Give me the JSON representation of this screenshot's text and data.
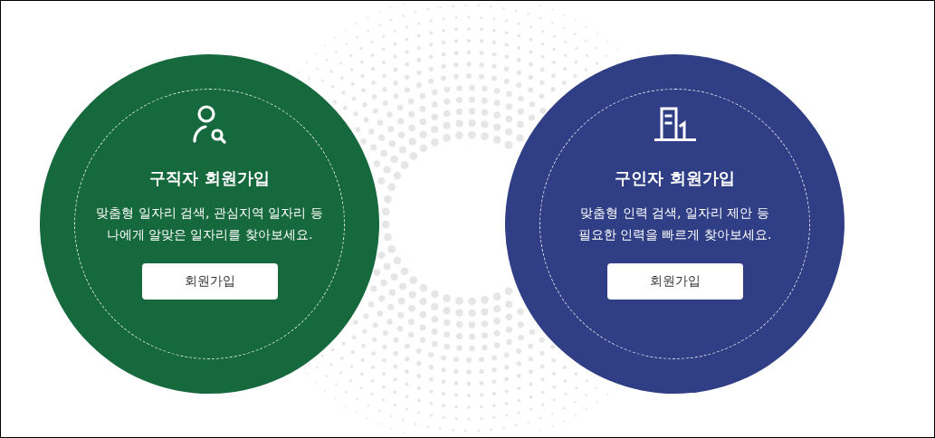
{
  "cards": [
    {
      "kind": "person-search",
      "color": "#15693d",
      "title": "구직자 회원가입",
      "lines": [
        "맞춤형 일자리 검색, 관심지역 일자리 등",
        "나에게 알맞은 일자리를 찾아보세요."
      ],
      "button": "회원가입"
    },
    {
      "kind": "building",
      "color": "#2f3e85",
      "title": "구인자 회원가입",
      "lines": [
        "맞춤형 인력 검색, 일자리 제안 등",
        "필요한 인력을 빠르게 찾아보세요."
      ],
      "button": "회원가입"
    }
  ]
}
